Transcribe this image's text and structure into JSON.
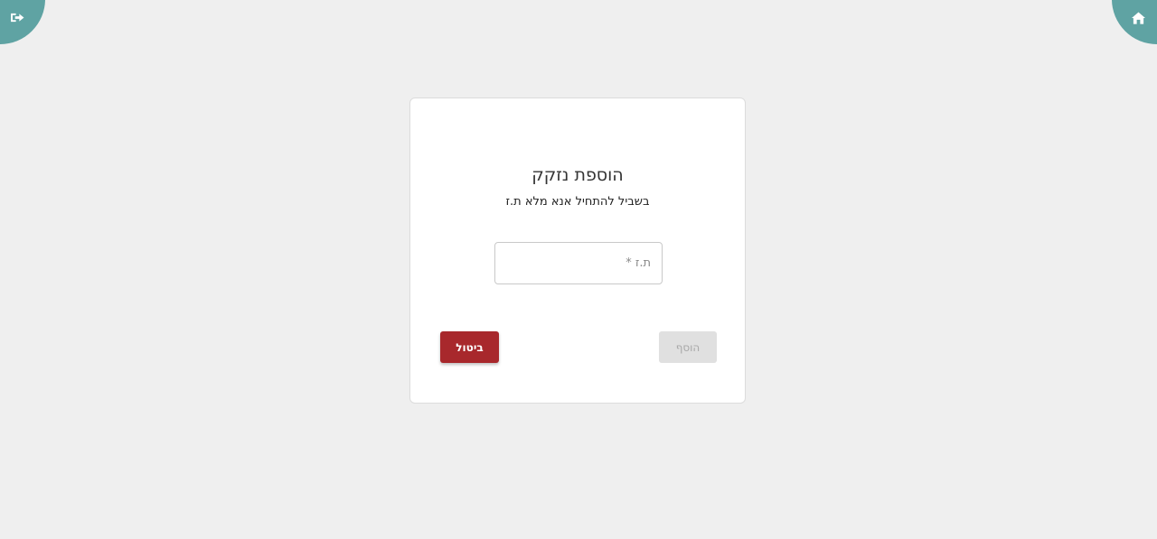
{
  "header": {
    "logout_icon": "sign-out-icon",
    "home_icon": "home-icon"
  },
  "dialog": {
    "title": "הוספת נזקק",
    "subtitle": "בשביל להתחיל אנא מלא ת.ז",
    "id_field": {
      "placeholder": "ת.ז *",
      "value": ""
    },
    "add_button_label": "הוסף",
    "cancel_button_label": "ביטול"
  },
  "colors": {
    "background": "#efefef",
    "accent": "#5fa3a3",
    "cancel": "#a8282c",
    "disabled": "#e0e0e0"
  }
}
